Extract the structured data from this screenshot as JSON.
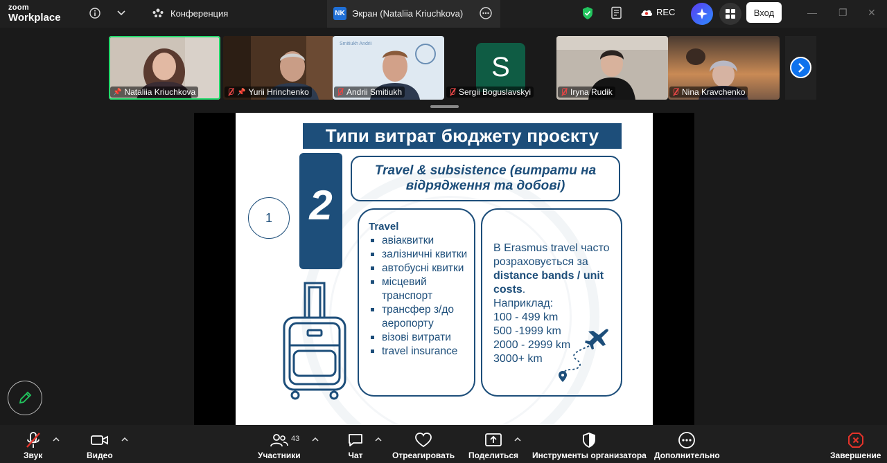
{
  "app": {
    "logo_line1": "zoom",
    "logo_line2": "Workplace"
  },
  "topbar": {
    "meeting_label": "Конференция",
    "share_tab_badge": "NK",
    "share_tab_label": "Экран (Nataliia Kriuchkova)",
    "rec_label": "REC",
    "signin_label": "Вход"
  },
  "participants": [
    {
      "name": "Nataliia Kriuchkova",
      "pinned": true,
      "muted": false,
      "active": true
    },
    {
      "name": "Yurii Hrinchenko",
      "pinned": true,
      "muted": true
    },
    {
      "name": "Andrii Smitiukh",
      "muted": true
    },
    {
      "name": "Sergii Boguslavskyi",
      "muted": true,
      "avatar_letter": "S"
    },
    {
      "name": "Iryna Rudik",
      "muted": true
    },
    {
      "name": "Nina Kravchenko",
      "muted": true
    }
  ],
  "slide": {
    "title": "Типи витрат бюджету проєкту",
    "big_number": "2",
    "circle_number": "1",
    "heading": "Travel & subsistence (витрати на відрядження та добові)",
    "left_box": {
      "header": "Travel",
      "items": [
        "авіаквитки",
        "залізничні квитки",
        "автобусні квитки",
        "місцевий транспорт",
        "трансфер з/до аеропорту",
        "візові витрати",
        "travel insurance"
      ]
    },
    "right_box": {
      "line1": "В Erasmus travel часто розраховується за",
      "bold": "distance bands / unit costs",
      "after_bold": ".",
      "example_label": "Наприклад:",
      "bands": [
        "100 - 499 km",
        "500 -1999 km",
        "2000 - 2999 km",
        "3000+ km"
      ]
    },
    "tile_caption_andrii": "Smitiukh Andrii"
  },
  "toolbar": {
    "audio": "Звук",
    "video": "Видео",
    "participants": "Участники",
    "participants_count": "43",
    "chat": "Чат",
    "react": "Отреагировать",
    "share": "Поделиться",
    "host_tools": "Инструменты организатора",
    "more": "Дополнительно",
    "end": "Завершение"
  },
  "colors": {
    "slide_navy": "#1d4e7a",
    "accent_blue": "#0e72ed",
    "end_red": "#e5332a",
    "active_green": "#23d96b"
  }
}
